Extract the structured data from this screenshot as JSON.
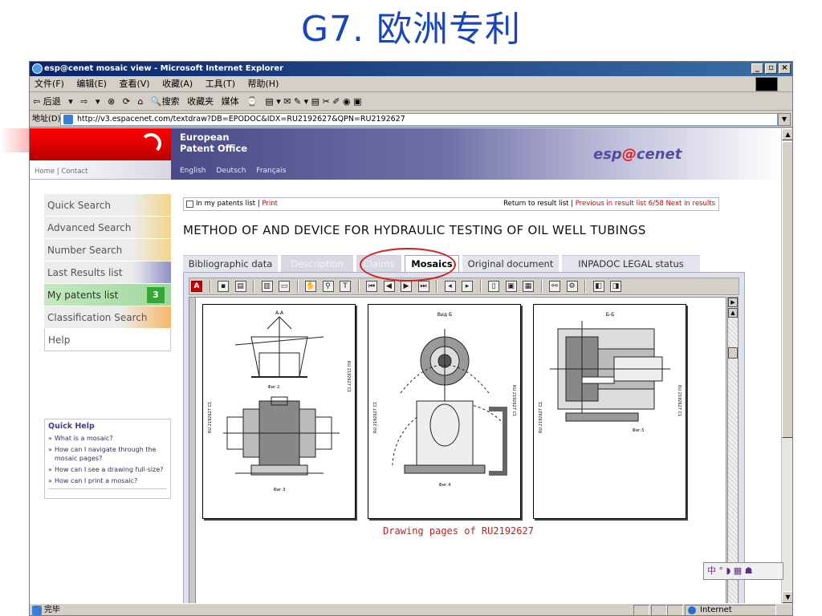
{
  "slide": {
    "title": "G7. 欧洲专利"
  },
  "window": {
    "title": "esp@cenet mosaic view - Microsoft Internet Explorer",
    "min_label": "_",
    "max_label": "▫",
    "close_label": "×"
  },
  "menubar": [
    "文件(F)",
    "编辑(E)",
    "查看(V)",
    "收藏(A)",
    "工具(T)",
    "帮助(H)"
  ],
  "toolbar": {
    "back": "⇦ 后退",
    "back_arrow": "▾",
    "forward": "⇨",
    "forward_arrow": "▾",
    "stop": "⊗",
    "refresh": "⟳",
    "home": "⌂",
    "search": "🔍搜索",
    "favorites": "收藏夹",
    "media": "媒体",
    "history": "⌚",
    "extra": "▤ ▾  ✉  ✎ ▾  ▤  ✂  ✐  ◉  ▣"
  },
  "address": {
    "label": "地址(D)",
    "url": "http://v3.espacenet.com/textdraw?DB=EPODOC&IDX=RU2192627&QPN=RU2192627",
    "dropdown": "▼"
  },
  "epo": {
    "name_line1": "European",
    "name_line2": "Patent Office",
    "home_contact": "Home | Contact",
    "languages": [
      "English",
      "Deutsch",
      "Français"
    ],
    "logo_pre": "esp",
    "logo_at": "@",
    "logo_post": "cenet"
  },
  "nav": {
    "items": [
      {
        "label": "Quick Search"
      },
      {
        "label": "Advanced Search"
      },
      {
        "label": "Number Search"
      },
      {
        "label": "Last Results list"
      },
      {
        "label": "My patents list",
        "badge": "3"
      },
      {
        "label": "Classification Search"
      },
      {
        "label": "Help"
      }
    ]
  },
  "quick_help": {
    "title": "Quick Help",
    "items": [
      "What is a mosaic?",
      "How can I navigate through the mosaic pages?",
      "How can I see a drawing full-size?",
      "How can I print a mosaic?"
    ]
  },
  "list_bar": {
    "my_list": "In my patents list",
    "sep1": "|",
    "print": "Print",
    "return": "Return to result list",
    "sep2": "|",
    "prev_next": "Previous in result list 6/58 Next in results"
  },
  "document": {
    "title": "METHOD OF AND DEVICE FOR HYDRAULIC TESTING OF OIL WELL TUBINGS"
  },
  "tabs": [
    {
      "label": "Bibliographic data"
    },
    {
      "label": "Description"
    },
    {
      "label": "Claims"
    },
    {
      "label": "Mosaics"
    },
    {
      "label": "Original document"
    },
    {
      "label": "INPADOC LEGAL status"
    }
  ],
  "viewer": {
    "caption": "Drawing pages of RU2192627",
    "pages": [
      {
        "fig_top": "A-A",
        "fig_bottom": "Фиг.3",
        "fig_mid": "Фиг.2"
      },
      {
        "fig_top": "Вид Б",
        "fig_bottom": "Фиг.4"
      },
      {
        "fig_top": "Б-Б",
        "fig_bottom": "Фиг.5"
      }
    ],
    "side_code": "RU 2192627 C1"
  },
  "ime": {
    "text": "中 ° ◗ ▦ ☗"
  },
  "status": {
    "done": "完毕",
    "zone": "Internet"
  }
}
